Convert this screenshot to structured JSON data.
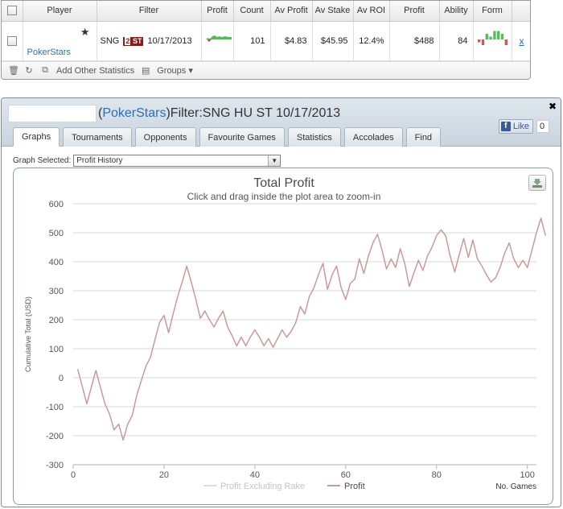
{
  "stats_table": {
    "headers": [
      "Player",
      "Filter",
      "Profit",
      "Count",
      "Av Profit",
      "Av Stake",
      "Av ROI",
      "Profit",
      "Ability",
      "Form"
    ],
    "row": {
      "player_name": "PokerStars",
      "filter_prefix": "SNG",
      "filter_badge_num": "2",
      "filter_badge_text": "ST",
      "filter_date": "10/17/2013",
      "count": "101",
      "av_profit": "$4.83",
      "av_stake": "$45.95",
      "av_roi": "12.4%",
      "profit": "$488",
      "ability": "84",
      "remove_label": "x"
    },
    "form_bars": [
      -1,
      -2,
      2,
      1,
      3,
      3,
      2,
      -2
    ],
    "toolbar": {
      "add_stats_label": "Add Other Statistics",
      "groups_label": "Groups"
    }
  },
  "results_panel": {
    "title_site": "PokerStars",
    "title_filter": "Filter:SNG HU ST 10/17/2013",
    "like_label": "Like",
    "like_count": "0",
    "tabs": [
      {
        "label": "Graphs",
        "active": true
      },
      {
        "label": "Tournaments",
        "active": false
      },
      {
        "label": "Opponents",
        "active": false
      },
      {
        "label": "Favourite Games",
        "active": false
      },
      {
        "label": "Statistics",
        "active": false
      },
      {
        "label": "Accolades",
        "active": false
      },
      {
        "label": "Find",
        "active": false
      }
    ],
    "graph_selected_label": "Graph Selected:",
    "graph_selected_value": "Profit History"
  },
  "chart_data": {
    "type": "line",
    "title": "Total Profit",
    "subtitle": "Click and drag inside the plot area to zoom-in",
    "xlabel": "No. Games",
    "ylabel": "Cumulative Total (USD)",
    "xlim": [
      0,
      102
    ],
    "ylim": [
      -300,
      600
    ],
    "xticks": [
      0,
      20,
      40,
      60,
      80,
      100
    ],
    "yticks": [
      -300,
      -200,
      -100,
      0,
      100,
      200,
      300,
      400,
      500,
      600
    ],
    "legend": [
      "Profit Excluding Rake",
      "Profit"
    ],
    "legend_position": "bottom",
    "colors": {
      "profit": "#c99a9a",
      "excluding_rake": "#dcdcdc",
      "grid": "#d8d8d8"
    },
    "series": [
      {
        "name": "Profit",
        "points": [
          [
            1,
            30
          ],
          [
            3,
            -90
          ],
          [
            5,
            25
          ],
          [
            7,
            -90
          ],
          [
            8,
            -125
          ],
          [
            9,
            -180
          ],
          [
            10,
            -160
          ],
          [
            11,
            -215
          ],
          [
            12,
            -160
          ],
          [
            13,
            -130
          ],
          [
            14,
            -60
          ],
          [
            15,
            -10
          ],
          [
            16,
            40
          ],
          [
            17,
            70
          ],
          [
            18,
            130
          ],
          [
            19,
            190
          ],
          [
            20,
            215
          ],
          [
            21,
            155
          ],
          [
            22,
            220
          ],
          [
            23,
            280
          ],
          [
            24,
            330
          ],
          [
            25,
            385
          ],
          [
            26,
            330
          ],
          [
            27,
            270
          ],
          [
            28,
            205
          ],
          [
            29,
            230
          ],
          [
            30,
            200
          ],
          [
            31,
            175
          ],
          [
            32,
            205
          ],
          [
            33,
            230
          ],
          [
            34,
            175
          ],
          [
            35,
            145
          ],
          [
            36,
            110
          ],
          [
            37,
            140
          ],
          [
            38,
            110
          ],
          [
            39,
            140
          ],
          [
            40,
            165
          ],
          [
            41,
            140
          ],
          [
            42,
            110
          ],
          [
            43,
            135
          ],
          [
            44,
            105
          ],
          [
            45,
            135
          ],
          [
            46,
            165
          ],
          [
            47,
            140
          ],
          [
            48,
            160
          ],
          [
            49,
            190
          ],
          [
            50,
            245
          ],
          [
            51,
            220
          ],
          [
            52,
            280
          ],
          [
            53,
            310
          ],
          [
            54,
            355
          ],
          [
            55,
            395
          ],
          [
            56,
            305
          ],
          [
            57,
            355
          ],
          [
            58,
            385
          ],
          [
            59,
            310
          ],
          [
            60,
            270
          ],
          [
            61,
            325
          ],
          [
            62,
            340
          ],
          [
            63,
            410
          ],
          [
            64,
            360
          ],
          [
            65,
            420
          ],
          [
            66,
            465
          ],
          [
            67,
            495
          ],
          [
            68,
            440
          ],
          [
            69,
            375
          ],
          [
            70,
            410
          ],
          [
            71,
            380
          ],
          [
            72,
            445
          ],
          [
            73,
            395
          ],
          [
            74,
            315
          ],
          [
            75,
            360
          ],
          [
            76,
            405
          ],
          [
            77,
            370
          ],
          [
            78,
            420
          ],
          [
            79,
            450
          ],
          [
            80,
            490
          ],
          [
            81,
            510
          ],
          [
            82,
            490
          ],
          [
            83,
            420
          ],
          [
            84,
            365
          ],
          [
            85,
            425
          ],
          [
            86,
            480
          ],
          [
            87,
            415
          ],
          [
            88,
            475
          ],
          [
            89,
            410
          ],
          [
            90,
            385
          ],
          [
            91,
            355
          ],
          [
            92,
            330
          ],
          [
            93,
            345
          ],
          [
            94,
            380
          ],
          [
            95,
            430
          ],
          [
            96,
            465
          ],
          [
            97,
            410
          ],
          [
            98,
            380
          ],
          [
            99,
            405
          ],
          [
            100,
            380
          ],
          [
            101,
            440
          ],
          [
            102,
            500
          ],
          [
            103,
            550
          ],
          [
            104,
            490
          ]
        ]
      }
    ]
  }
}
